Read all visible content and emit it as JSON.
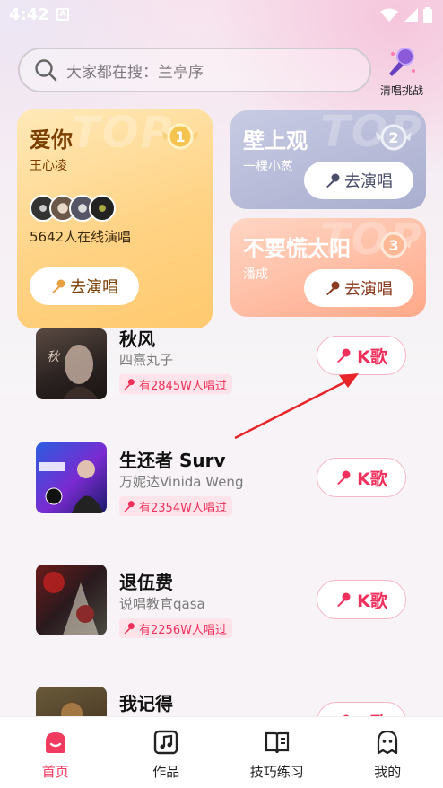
{
  "status_bar": {
    "time": "4:42",
    "badge": "A"
  },
  "search": {
    "placeholder": "大家都在搜：兰亭序"
  },
  "challenge": {
    "label": "清唱挑战"
  },
  "top_cards": [
    {
      "title": "爱你",
      "artist": "王心凌",
      "online_text": "5642人在线演唱",
      "button": "去演唱",
      "watermark": "TOP",
      "rank": "1"
    },
    {
      "title": "壁上观",
      "artist": "一棵小葱",
      "button": "去演唱",
      "watermark": "TOP",
      "rank": "2"
    },
    {
      "title": "不要慌太阳",
      "artist": "潘成",
      "button": "去演唱",
      "watermark": "TOP",
      "rank": "3"
    }
  ],
  "songs": [
    {
      "title": "秋风",
      "artist": "四熹丸子",
      "badge": "有2845W人唱过",
      "button": "K歌"
    },
    {
      "title": "生还者 Surv",
      "artist": "万妮达Vinida Weng",
      "badge": "有2354W人唱过",
      "button": "K歌"
    },
    {
      "title": "退伍费",
      "artist": "说唱教官qasa",
      "badge": "有2256W人唱过",
      "button": "K歌"
    },
    {
      "title": "我记得",
      "artist": "",
      "badge": "",
      "button": "K歌"
    }
  ],
  "nav": [
    {
      "label": "首页",
      "icon": "home-icon",
      "active": true
    },
    {
      "label": "作品",
      "icon": "music-note-icon",
      "active": false
    },
    {
      "label": "技巧练习",
      "icon": "book-icon",
      "active": false
    },
    {
      "label": "我的",
      "icon": "ghost-icon",
      "active": false
    }
  ],
  "colors": {
    "accent": "#f0305c",
    "card1": "#ffd385",
    "card2": "#a9aecf",
    "card3": "#ffa98a"
  }
}
